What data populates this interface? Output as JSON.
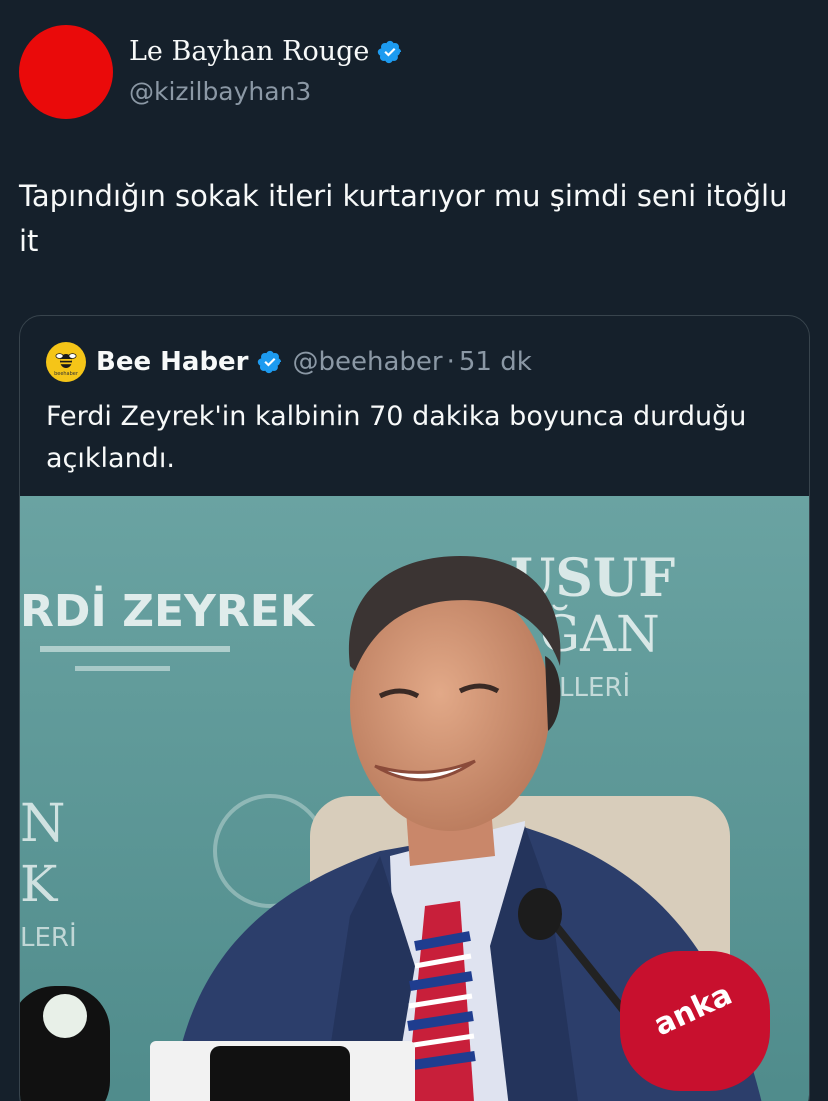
{
  "author": {
    "display_name": "Le Bayhan Rouge",
    "handle": "@kizilbayhan3",
    "avatar_color": "#ea0a0a",
    "verified_icon": "verified-badge-icon"
  },
  "tweet": {
    "text": "Tapındığın sokak itleri kurtarıyor mu şimdi seni itoğlu it"
  },
  "quote": {
    "display_name": "Bee Haber",
    "handle": "@beehaber",
    "separator": "·",
    "time": "51 dk",
    "logo_text": "beehaber",
    "text": "Ferdi Zeyrek'in kalbinin 70 dakika boyunca durduğu açıklandı.",
    "image_backdrop": {
      "left_lines": [
        "RDİ ZEYREK"
      ],
      "right_lines": [
        "USUF",
        "ĞAN",
        "ÜLLERİ"
      ],
      "left_edge_letters": [
        "N",
        "K",
        "LERİ"
      ]
    },
    "image_mic_label": "anka"
  },
  "colors": {
    "background": "#15202b",
    "text_primary": "#f7f9f9",
    "text_secondary": "#8b98a5",
    "border": "#38444d",
    "verified_blue": "#1d9bf0",
    "backdrop_teal": "#5f9c9c"
  }
}
